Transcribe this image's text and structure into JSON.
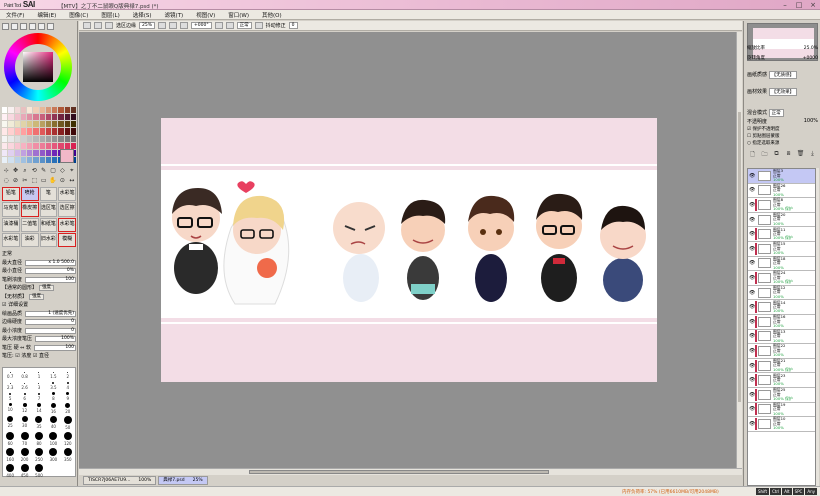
{
  "window": {
    "app": "SAI",
    "app_prefix": "Paint Tool",
    "title": "【MTV】之丁不二鼠眼Q版典禄7.psd (*)",
    "buttons": [
      "–",
      "□",
      "×"
    ]
  },
  "menu": [
    "文件(F)",
    "编辑(E)",
    "图像(C)",
    "图层(L)",
    "选择(S)",
    "滤镜(T)",
    "视图(V)",
    "窗口(W)",
    "其他(O)"
  ],
  "toolbar": {
    "anti_alias": "选区边缘",
    "zoom": "25%",
    "angle": "+000°",
    "mode": "正常",
    "stabilizer_label": "抖动修正",
    "stabilizer": "0"
  },
  "tools": {
    "icons": [
      "⊹",
      "✥",
      "⌕",
      "⟲",
      "✎",
      "▢",
      "◇",
      "⌖",
      "◌",
      "⊘",
      "✂",
      "⬚",
      "▭",
      "✋",
      "⊙",
      "↔"
    ],
    "brushes": [
      {
        "label": "铅笔",
        "red": true,
        "sel": false
      },
      {
        "label": "喷枪",
        "red": true,
        "sel": true
      },
      {
        "label": "笔",
        "red": false,
        "sel": false
      },
      {
        "label": "水彩笔",
        "red": false,
        "sel": false
      },
      {
        "label": "马克笔",
        "red": false,
        "sel": false
      },
      {
        "label": "橡皮擦",
        "red": true,
        "sel": false
      },
      {
        "label": "选区笔",
        "red": false,
        "sel": false
      },
      {
        "label": "选区擦",
        "red": false,
        "sel": false
      },
      {
        "label": "油漆桶",
        "red": false,
        "sel": false
      },
      {
        "label": "二值笔",
        "red": false,
        "sel": false
      },
      {
        "label": "和纸笔",
        "red": false,
        "sel": false
      },
      {
        "label": "水彩笔",
        "red": true,
        "sel": false
      },
      {
        "label": "水彩笔",
        "red": false,
        "sel": false
      },
      {
        "label": "油彩",
        "red": false,
        "sel": false
      },
      {
        "label": "旧水彩",
        "red": false,
        "sel": false
      },
      {
        "label": "模糊",
        "red": true,
        "sel": false
      }
    ]
  },
  "brush_props": [
    {
      "label": "正常",
      "value": "",
      "btn": ""
    },
    {
      "label": "最大直径",
      "value": "x 1.0     500.0",
      "btn": ""
    },
    {
      "label": "最小直径",
      "value": "0%",
      "btn": ""
    },
    {
      "label": "笔刷浓度",
      "value": "100",
      "btn": ""
    },
    {
      "label": "【通常的圆形】",
      "value": "",
      "btn": "强度"
    },
    {
      "label": "【无材质】",
      "value": "",
      "btn": "强度"
    },
    {
      "label": "☑ 详细设置",
      "value": "",
      "btn": ""
    },
    {
      "label": "绘画品质",
      "value": "1 (速度优先)",
      "btn": ""
    },
    {
      "label": "边缘硬度",
      "value": "0",
      "btn": ""
    },
    {
      "label": "最小浓度",
      "value": "0",
      "btn": ""
    },
    {
      "label": "最大浓度笔压",
      "value": "100%",
      "btn": ""
    },
    {
      "label": "笔压 硬 ⇔ 软",
      "value": "100",
      "btn": ""
    },
    {
      "label": "笔压: ☑ 浓度 ☑ 直径",
      "value": "",
      "btn": ""
    }
  ],
  "brush_sizes": [
    {
      "n": "0.7",
      "d": 1
    },
    {
      "n": "0.8",
      "d": 1
    },
    {
      "n": "1",
      "d": 1
    },
    {
      "n": "1.5",
      "d": 1
    },
    {
      "n": "2",
      "d": 1
    },
    {
      "n": "2.3",
      "d": 1
    },
    {
      "n": "2.6",
      "d": 1
    },
    {
      "n": "3",
      "d": 1
    },
    {
      "n": "3.5",
      "d": 2
    },
    {
      "n": "4",
      "d": 2
    },
    {
      "n": "5",
      "d": 2
    },
    {
      "n": "6",
      "d": 2
    },
    {
      "n": "7",
      "d": 2
    },
    {
      "n": "8",
      "d": 3
    },
    {
      "n": "9",
      "d": 3
    },
    {
      "n": "10",
      "d": 3
    },
    {
      "n": "12",
      "d": 4
    },
    {
      "n": "14",
      "d": 4
    },
    {
      "n": "16",
      "d": 5
    },
    {
      "n": "20",
      "d": 5
    },
    {
      "n": "25",
      "d": 6
    },
    {
      "n": "30",
      "d": 6
    },
    {
      "n": "35",
      "d": 7
    },
    {
      "n": "40",
      "d": 7
    },
    {
      "n": "50",
      "d": 8
    },
    {
      "n": "60",
      "d": 8
    },
    {
      "n": "70",
      "d": 8
    },
    {
      "n": "80",
      "d": 8
    },
    {
      "n": "100",
      "d": 8
    },
    {
      "n": "120",
      "d": 8
    },
    {
      "n": "160",
      "d": 8
    },
    {
      "n": "200",
      "d": 8
    },
    {
      "n": "250",
      "d": 8
    },
    {
      "n": "300",
      "d": 8
    },
    {
      "n": "350",
      "d": 8
    },
    {
      "n": "400",
      "d": 8
    },
    {
      "n": "450",
      "d": 8
    },
    {
      "n": "500",
      "d": 8
    },
    {
      "n": "",
      "d": 0
    },
    {
      "n": "",
      "d": 0
    }
  ],
  "palette": [
    "#ffffff",
    "#f8f0f0",
    "#f0d8d8",
    "#e8c0c0",
    "#f8e8d8",
    "#f0d0b8",
    "#e8b898",
    "#d89878",
    "#c87858",
    "#b05838",
    "#8a4028",
    "#603020",
    "#fff0f4",
    "#f8d8e0",
    "#f0c0cc",
    "#e8a8b8",
    "#e090a4",
    "#d87890",
    "#c8607c",
    "#b04868",
    "#903454",
    "#702440",
    "#501830",
    "#300c1c",
    "#f8f8f0",
    "#f0ecd8",
    "#e8e0c0",
    "#e0d4a8",
    "#d8c890",
    "#ccb878",
    "#b8a060",
    "#a08848",
    "#887030",
    "#705820",
    "#584010",
    "#403000",
    "#ffe8e8",
    "#ffd0d0",
    "#ffb8b8",
    "#ffa0a0",
    "#ff8888",
    "#f07070",
    "#e05858",
    "#c84040",
    "#a83030",
    "#882020",
    "#601010",
    "#400808",
    "#f4f4f4",
    "#e8e8e8",
    "#dcdcdc",
    "#d0d0d0",
    "#c4c4c4",
    "#b8b8b8",
    "#acacac",
    "#a0a0a0",
    "#949494",
    "#888888",
    "#7c7c7c",
    "#707070",
    "#fde8ec",
    "#fbd6de",
    "#f8c4d0",
    "#f6b2c2",
    "#f3a0b4",
    "#f08ea6",
    "#ec7c98",
    "#e86a8a",
    "#e4587c",
    "#e0466e",
    "#dc3460",
    "#d82252",
    "#f0e8f8",
    "#e0d0f0",
    "#d0b8e8",
    "#c0a0e0",
    "#b088d8",
    "#a070d0",
    "#9058c8",
    "#8040c0",
    "#7028b8",
    "#6010b0",
    "#5008a0",
    "#400090",
    "#e8f0f8",
    "#d0e0f0",
    "#b8d0e8",
    "#a0c0e0",
    "#88b0d8",
    "#70a0d0",
    "#5890c8",
    "#4080c0",
    "#2870b8",
    "#1060b0",
    "#0850a0",
    "#004090"
  ],
  "right_panel": {
    "nav_zoom_label": "缩放比率",
    "nav_zoom": "25.0%",
    "nav_angle_label": "旋转角度",
    "nav_angle": "+0000",
    "paper_label": "画纸质感",
    "paper": "【无质感】",
    "material_label": "画材效果",
    "material": "【无效果】",
    "blend_label": "混合模式",
    "blend": "正常",
    "opacity_label": "不透明度",
    "opacity": "100%",
    "check1": "☑ 保护不透明度",
    "check2": "☐ 剪贴图层蒙版",
    "check3": "○ 指定选取来源",
    "layer_icons": [
      "🗋",
      "🗀",
      "⧉",
      "⧈",
      "🗑",
      "⤓"
    ]
  },
  "layers": [
    {
      "name": "图层3",
      "mode": "正常",
      "op": "100%",
      "sel": true,
      "mark": false
    },
    {
      "name": "图层26",
      "mode": "正常",
      "op": "100%",
      "sel": false,
      "mark": false
    },
    {
      "name": "图层8",
      "mode": "正常",
      "op": "100% 保护",
      "sel": false,
      "mark": true
    },
    {
      "name": "图层20",
      "mode": "正常",
      "op": "100%",
      "sel": false,
      "mark": false
    },
    {
      "name": "图层11",
      "mode": "正常",
      "op": "100% 保护",
      "sel": false,
      "mark": true
    },
    {
      "name": "图层15",
      "mode": "正常",
      "op": "100%",
      "sel": false,
      "mark": true
    },
    {
      "name": "图层18",
      "mode": "正常",
      "op": "100%",
      "sel": false,
      "mark": false
    },
    {
      "name": "图层24",
      "mode": "正常",
      "op": "100% 保护",
      "sel": false,
      "mark": true
    },
    {
      "name": "图层12",
      "mode": "正常",
      "op": "100%",
      "sel": false,
      "mark": false
    },
    {
      "name": "图层14",
      "mode": "正常",
      "op": "100%",
      "sel": false,
      "mark": true
    },
    {
      "name": "图层16",
      "mode": "正常",
      "op": "100%",
      "sel": false,
      "mark": true
    },
    {
      "name": "图层13",
      "mode": "正常",
      "op": "100%",
      "sel": false,
      "mark": true
    },
    {
      "name": "图层22",
      "mode": "正常",
      "op": "100%",
      "sel": false,
      "mark": true
    },
    {
      "name": "图层21",
      "mode": "正常",
      "op": "100% 保护",
      "sel": false,
      "mark": true
    },
    {
      "name": "图层23",
      "mode": "正常",
      "op": "100%",
      "sel": false,
      "mark": true
    },
    {
      "name": "图层25",
      "mode": "正常",
      "op": "100% 保护",
      "sel": false,
      "mark": true
    },
    {
      "name": "图层19",
      "mode": "正常",
      "op": "100%",
      "sel": false,
      "mark": true
    },
    {
      "name": "图层10",
      "mode": "正常",
      "op": "100%",
      "sel": false,
      "mark": true
    }
  ],
  "tabs": [
    {
      "name": "TISCR7J06AE7U9...",
      "zoom": "100%",
      "active": false
    },
    {
      "name": "典禄7.psd",
      "zoom": "25%",
      "active": true
    }
  ],
  "status": {
    "memory": "内存负荷率: 57% (已用6610MB/可用2048MB)",
    "keys": [
      "Shift",
      "Ctrl",
      "Alt",
      "SPC",
      "Any"
    ]
  }
}
